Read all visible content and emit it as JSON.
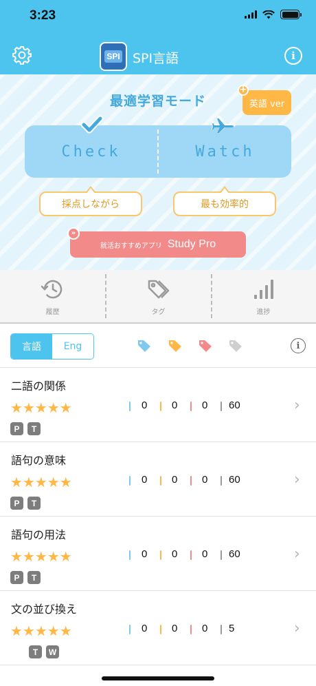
{
  "status_bar": {
    "time": "3:23"
  },
  "header": {
    "title": "SPI言語",
    "logo_text": "SPI"
  },
  "hero": {
    "mode_title": "最適学習モード",
    "english_badge": "英語 ver",
    "check_label": "Check",
    "watch_label": "Watch",
    "check_caption": "採点しながら",
    "watch_caption": "最も効率的",
    "promo_small": "就活おすすめアプリ",
    "promo_big": "Study Pro"
  },
  "tabs": [
    {
      "label": "履歴",
      "icon": "history-icon"
    },
    {
      "label": "タグ",
      "icon": "tags-icon"
    },
    {
      "label": "進捗",
      "icon": "progress-bars-icon"
    }
  ],
  "filter": {
    "segment_selected": "言語",
    "segment_other": "Eng",
    "tag_colors": [
      "#7ec9ee",
      "#ffb745",
      "#f28a8a",
      "#cfcfcf"
    ]
  },
  "colors": {
    "accent": "#4cc4ee",
    "star": "#ffb745",
    "count_blue": "#7ec9ee",
    "count_orange": "#ffb745",
    "count_red": "#f28a8a",
    "count_gray": "#9a9a9a"
  },
  "rows": [
    {
      "title": "二語の関係",
      "stars": "★★★★★",
      "c1": "0",
      "c2": "0",
      "c3": "0",
      "total": "60",
      "badges": [
        "P",
        "T"
      ]
    },
    {
      "title": "語句の意味",
      "stars": "★★★★★",
      "c1": "0",
      "c2": "0",
      "c3": "0",
      "total": "60",
      "badges": [
        "P",
        "T"
      ]
    },
    {
      "title": "語句の用法",
      "stars": "★★★★★",
      "c1": "0",
      "c2": "0",
      "c3": "0",
      "total": "60",
      "badges": [
        "P",
        "T"
      ]
    },
    {
      "title": "文の並び換え",
      "stars": "★★★★★",
      "c1": "0",
      "c2": "0",
      "c3": "0",
      "total": "5",
      "badges": [
        "T",
        "W"
      ]
    }
  ]
}
